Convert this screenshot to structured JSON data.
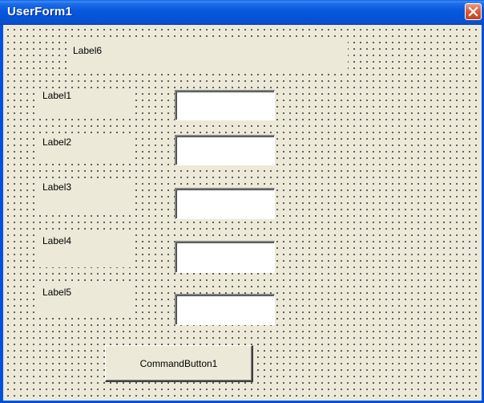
{
  "window": {
    "title": "UserForm1"
  },
  "form": {
    "labels": {
      "label6": "Label6",
      "label1": "Label1",
      "label2": "Label2",
      "label3": "Label3",
      "label4": "Label4",
      "label5": "Label5"
    },
    "textboxes": [
      {
        "value": ""
      },
      {
        "value": ""
      },
      {
        "value": ""
      },
      {
        "value": ""
      },
      {
        "value": ""
      }
    ],
    "command_button_label": "CommandButton1"
  },
  "icons": {
    "close": "close-icon"
  },
  "colors": {
    "titlebar": "#0054e3",
    "client_background": "#ece9d8",
    "close_button": "#d4542f"
  }
}
